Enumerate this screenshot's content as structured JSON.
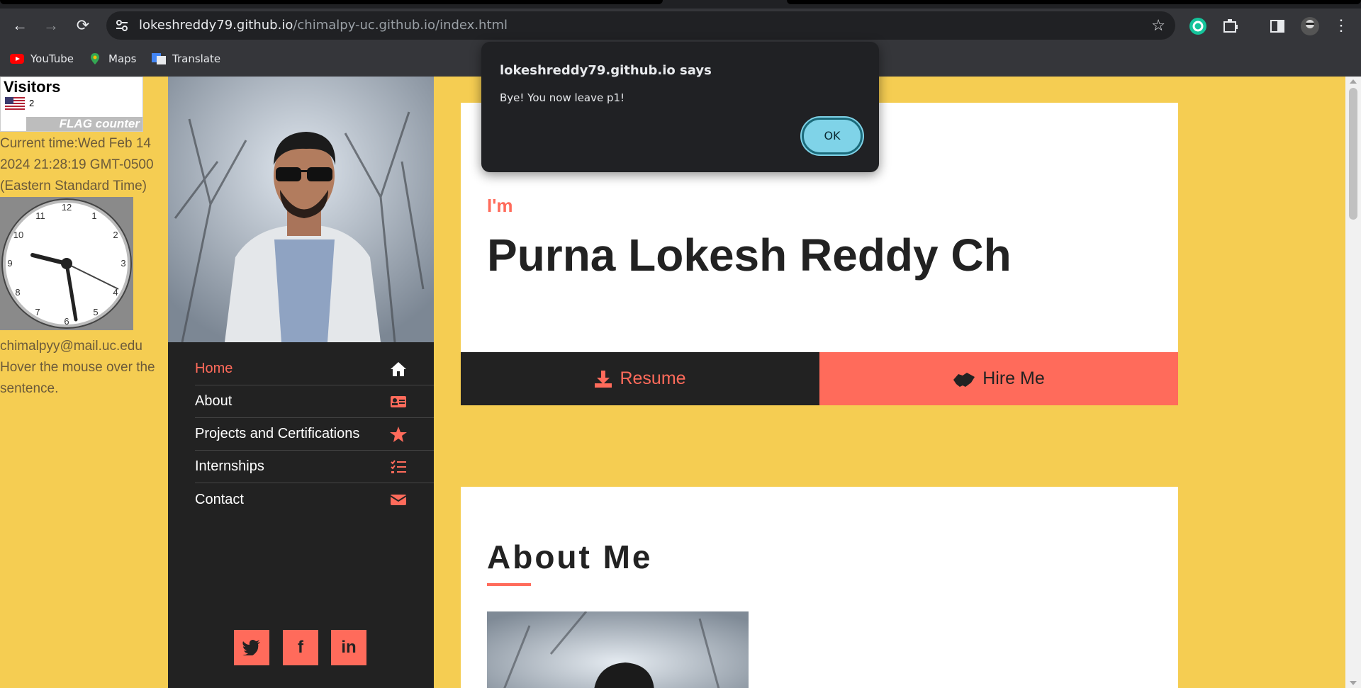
{
  "browser": {
    "url_host": "lokeshreddy79.github.io",
    "url_path": "/chimalpy-uc.github.io/index.html",
    "bookmarks": [
      "YouTube",
      "Maps",
      "Translate"
    ]
  },
  "left": {
    "visitors_title": "Visitors",
    "visitor_count": "2",
    "flag_counter": "FLAG counter",
    "time_text": "Current time:Wed Feb 14 2024 21:28:19 GMT-0500 (Eastern Standard Time)",
    "email_text": "chimalpyy@mail.uc.edu Hover the mouse over the sentence."
  },
  "menu": [
    {
      "label": "Home",
      "icon": "home-icon"
    },
    {
      "label": "About",
      "icon": "id-card-icon"
    },
    {
      "label": "Projects and Certifications",
      "icon": "star-icon"
    },
    {
      "label": "Internships",
      "icon": "list-check-icon"
    },
    {
      "label": "Contact",
      "icon": "envelope-icon"
    }
  ],
  "social": {
    "twitter": "🐦",
    "facebook": "f",
    "linkedin": "in"
  },
  "hero": {
    "intro": "I'm",
    "name": "Purna Lokesh Reddy Ch",
    "resume_label": "Resume",
    "hire_label": "Hire Me"
  },
  "about": {
    "title": "About Me"
  },
  "dialog": {
    "title": "lokeshreddy79.github.io says",
    "message": "Bye! You now leave p1!",
    "ok_label": "OK"
  },
  "colors": {
    "accent": "#ff6b5b",
    "page_bg": "#f5cd52",
    "sidebar_bg": "#222222"
  }
}
